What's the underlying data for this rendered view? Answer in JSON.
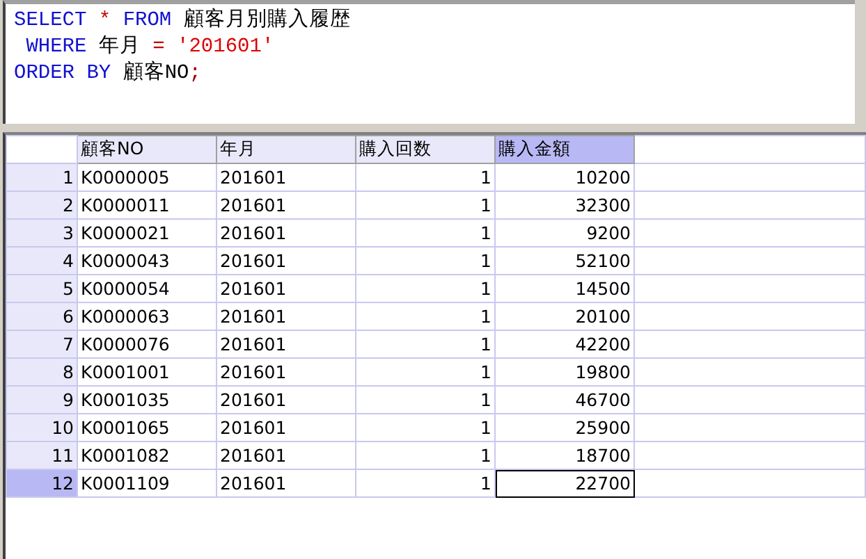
{
  "editor": {
    "lines": [
      [
        {
          "kind": "keyword",
          "text": "SELECT"
        },
        {
          "kind": "operator",
          "text": "*"
        },
        {
          "kind": "keyword",
          "text": "FROM"
        },
        {
          "kind": "identifier",
          "text": "顧客月別購入履歴"
        }
      ],
      [
        {
          "kind": "keyword",
          "text": " WHERE"
        },
        {
          "kind": "identifier",
          "text": "年月"
        },
        {
          "kind": "operator",
          "text": "="
        },
        {
          "kind": "string",
          "text": "'201601'"
        }
      ],
      [
        {
          "kind": "keyword",
          "text": "ORDER BY"
        },
        {
          "kind": "identifier",
          "text": "顧客NO"
        },
        {
          "kind": "punct",
          "text": ";"
        }
      ]
    ]
  },
  "grid": {
    "columns": [
      {
        "label": "顧客NO",
        "kind": "text",
        "selected": false
      },
      {
        "label": "年月",
        "kind": "text",
        "selected": false
      },
      {
        "label": "購入回数",
        "kind": "number",
        "selected": false
      },
      {
        "label": "購入金額",
        "kind": "number",
        "selected": true
      }
    ],
    "rows": [
      {
        "number": "1",
        "selected": false,
        "cells": [
          {
            "value": "K0000005",
            "focused": false
          },
          {
            "value": "201601",
            "focused": false
          },
          {
            "value": "1",
            "focused": false
          },
          {
            "value": "10200",
            "focused": false
          }
        ]
      },
      {
        "number": "2",
        "selected": false,
        "cells": [
          {
            "value": "K0000011",
            "focused": false
          },
          {
            "value": "201601",
            "focused": false
          },
          {
            "value": "1",
            "focused": false
          },
          {
            "value": "32300",
            "focused": false
          }
        ]
      },
      {
        "number": "3",
        "selected": false,
        "cells": [
          {
            "value": "K0000021",
            "focused": false
          },
          {
            "value": "201601",
            "focused": false
          },
          {
            "value": "1",
            "focused": false
          },
          {
            "value": "9200",
            "focused": false
          }
        ]
      },
      {
        "number": "4",
        "selected": false,
        "cells": [
          {
            "value": "K0000043",
            "focused": false
          },
          {
            "value": "201601",
            "focused": false
          },
          {
            "value": "1",
            "focused": false
          },
          {
            "value": "52100",
            "focused": false
          }
        ]
      },
      {
        "number": "5",
        "selected": false,
        "cells": [
          {
            "value": "K0000054",
            "focused": false
          },
          {
            "value": "201601",
            "focused": false
          },
          {
            "value": "1",
            "focused": false
          },
          {
            "value": "14500",
            "focused": false
          }
        ]
      },
      {
        "number": "6",
        "selected": false,
        "cells": [
          {
            "value": "K0000063",
            "focused": false
          },
          {
            "value": "201601",
            "focused": false
          },
          {
            "value": "1",
            "focused": false
          },
          {
            "value": "20100",
            "focused": false
          }
        ]
      },
      {
        "number": "7",
        "selected": false,
        "cells": [
          {
            "value": "K0000076",
            "focused": false
          },
          {
            "value": "201601",
            "focused": false
          },
          {
            "value": "1",
            "focused": false
          },
          {
            "value": "42200",
            "focused": false
          }
        ]
      },
      {
        "number": "8",
        "selected": false,
        "cells": [
          {
            "value": "K0001001",
            "focused": false
          },
          {
            "value": "201601",
            "focused": false
          },
          {
            "value": "1",
            "focused": false
          },
          {
            "value": "19800",
            "focused": false
          }
        ]
      },
      {
        "number": "9",
        "selected": false,
        "cells": [
          {
            "value": "K0001035",
            "focused": false
          },
          {
            "value": "201601",
            "focused": false
          },
          {
            "value": "1",
            "focused": false
          },
          {
            "value": "46700",
            "focused": false
          }
        ]
      },
      {
        "number": "10",
        "selected": false,
        "cells": [
          {
            "value": "K0001065",
            "focused": false
          },
          {
            "value": "201601",
            "focused": false
          },
          {
            "value": "1",
            "focused": false
          },
          {
            "value": "25900",
            "focused": false
          }
        ]
      },
      {
        "number": "11",
        "selected": false,
        "cells": [
          {
            "value": "K0001082",
            "focused": false
          },
          {
            "value": "201601",
            "focused": false
          },
          {
            "value": "1",
            "focused": false
          },
          {
            "value": "18700",
            "focused": false
          }
        ]
      },
      {
        "number": "12",
        "selected": true,
        "cells": [
          {
            "value": "K0001109",
            "focused": false
          },
          {
            "value": "201601",
            "focused": false
          },
          {
            "value": "1",
            "focused": false
          },
          {
            "value": "22700",
            "focused": true
          }
        ]
      }
    ]
  }
}
